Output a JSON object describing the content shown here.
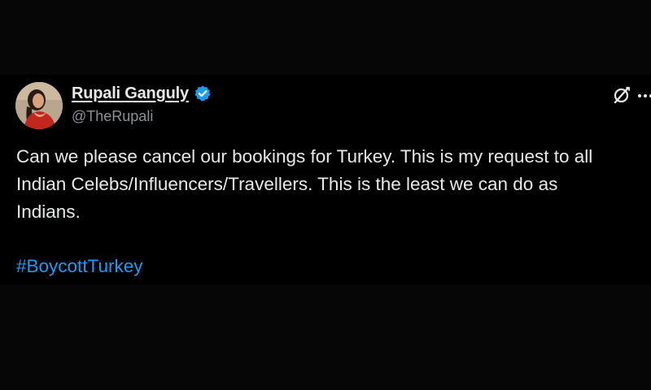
{
  "tweet": {
    "author": {
      "display_name": "Rupali Ganguly",
      "handle": "@TheRupali",
      "verified": true,
      "avatar": "profile-photo"
    },
    "body_lines": [
      "Can we please cancel our bookings for Turkey. This is my request to all",
      "Indian Celebs/Influencers/Travellers. This is the least we can do as",
      "Indians."
    ],
    "hashtag": "#BoycottTurkey",
    "icons": {
      "verified": "verified-badge-icon",
      "grok": "grok-icon",
      "more": "more-options-icon"
    }
  },
  "colors": {
    "background": "#000000",
    "text": "#e7e9ea",
    "secondary_text": "#8b9096",
    "accent": "#1d9bf0"
  }
}
